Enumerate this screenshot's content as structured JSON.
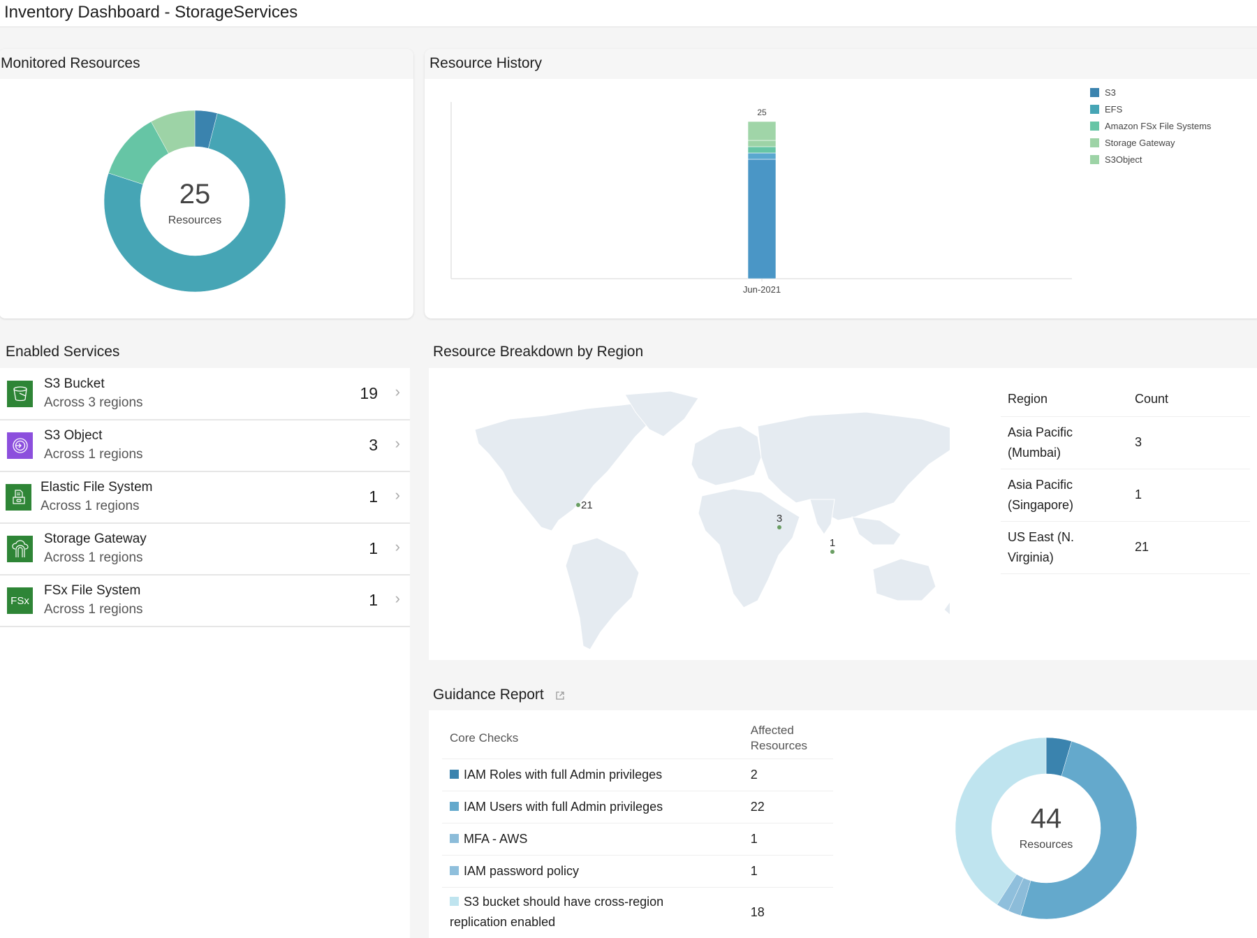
{
  "window": {
    "title": "Inventory Dashboard - StorageServices"
  },
  "monitored": {
    "title": "Monitored Resources",
    "total": "25",
    "total_label": "Resources"
  },
  "history": {
    "title": "Resource History"
  },
  "services": {
    "title": "Enabled Services",
    "items": [
      {
        "name": "S3 Bucket",
        "sub": "Across 3 regions",
        "count": "19",
        "icon": "s3-bucket-icon",
        "color": "#2e8536"
      },
      {
        "name": "S3 Object",
        "sub": "Across 1 regions",
        "count": "3",
        "icon": "s3-object-icon",
        "color": "#8c4fdd"
      },
      {
        "name": "Elastic File System",
        "sub": "Across 1 regions",
        "count": "1",
        "icon": "efs-icon",
        "color": "#2e8536"
      },
      {
        "name": "Storage Gateway",
        "sub": "Across 1 regions",
        "count": "1",
        "icon": "storage-gateway-icon",
        "color": "#2e8536"
      },
      {
        "name": "FSx File System",
        "sub": "Across 1 regions",
        "count": "1",
        "icon": "fsx-icon",
        "icon_text": "FSx",
        "color": "#2e8536"
      }
    ]
  },
  "regions": {
    "title": "Resource Breakdown by Region",
    "columns": [
      "Region",
      "Count"
    ],
    "rows": [
      {
        "region": "Asia Pacific (Mumbai)",
        "count": "3"
      },
      {
        "region": "Asia Pacific (Singapore)",
        "count": "1"
      },
      {
        "region": "US East (N. Virginia)",
        "count": "21"
      }
    ],
    "map_markers": [
      {
        "label": "21",
        "region": "US East (N. Virginia)"
      },
      {
        "label": "3",
        "region": "Asia Pacific (Mumbai)"
      },
      {
        "label": "1",
        "region": "Asia Pacific (Singapore)"
      }
    ]
  },
  "guidance": {
    "title": "Guidance Report",
    "columns": [
      "Core Checks",
      "Affected Resources"
    ],
    "rows": [
      {
        "check": "IAM Roles with full Admin privileges",
        "count": "2",
        "color": "#3a83ae"
      },
      {
        "check": "IAM Users with full Admin privileges",
        "count": "22",
        "color": "#64a9cc"
      },
      {
        "check": "MFA - AWS",
        "count": "1",
        "color": "#8cbcd9"
      },
      {
        "check": "IAM password policy",
        "count": "1",
        "color": "#8fbfdc"
      },
      {
        "check": "S3 bucket should have cross-region replication enabled",
        "count": "18",
        "color": "#bfe4ef"
      }
    ],
    "total": "44",
    "total_label": "Resources"
  },
  "chart_data": [
    {
      "type": "pie",
      "title": "Monitored Resources",
      "center_text": "25 Resources",
      "labels": [
        "S3Object",
        "S3",
        "EFS",
        "Amazon FSx File Systems",
        "Storage Gateway"
      ],
      "values": [
        1,
        19,
        3,
        2,
        0
      ],
      "colors": [
        "#3a83ae",
        "#46a5b5",
        "#66c5a5",
        "#9dd3a6",
        "#9dd3a6"
      ],
      "note": "approximate donut slices read clockwise from top"
    },
    {
      "type": "bar",
      "stacked": true,
      "title": "Resource History",
      "categories": [
        "Jun-2021"
      ],
      "series": [
        {
          "name": "S3",
          "values": [
            19
          ],
          "color": "#4a96c6"
        },
        {
          "name": "EFS",
          "values": [
            1
          ],
          "color": "#5aa8cf"
        },
        {
          "name": "Amazon FSx File Systems",
          "values": [
            1
          ],
          "color": "#66c5a5"
        },
        {
          "name": "Storage Gateway",
          "values": [
            1
          ],
          "color": "#9dd3a6"
        },
        {
          "name": "S3Object",
          "values": [
            3
          ],
          "color": "#a0d5a8"
        }
      ],
      "totals": [
        "25"
      ],
      "legend": "top-right",
      "legend_colors": [
        "#3a83ae",
        "#46a5b5",
        "#66c5a5",
        "#9dd3a6",
        "#9dd3a6"
      ],
      "ylim": [
        0,
        25
      ]
    },
    {
      "type": "pie",
      "title": "Guidance Report",
      "center_text": "44 Resources",
      "labels": [
        "IAM Roles with full Admin privileges",
        "IAM Users with full Admin privileges",
        "MFA - AWS",
        "IAM password policy",
        "S3 bucket should have cross-region replication enabled"
      ],
      "values": [
        2,
        22,
        1,
        1,
        18
      ],
      "colors": [
        "#3a83ae",
        "#64a9cc",
        "#8cbcd9",
        "#8fbfdc",
        "#bfe4ef"
      ]
    }
  ]
}
